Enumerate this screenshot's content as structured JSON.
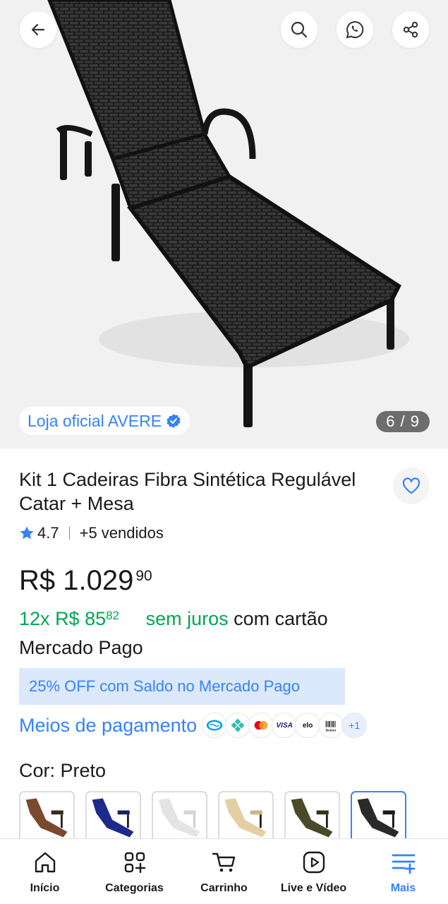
{
  "gallery": {
    "store_label": "Loja oficial AVERE",
    "counter": "6 / 9"
  },
  "product": {
    "title": "Kit 1 Cadeiras Fibra Sintética Regulável Catar + Mesa",
    "rating": "4.7",
    "sold": "+5 vendidos",
    "price_integer": "R$ 1.029",
    "price_cents": "90",
    "installments_count": "12x",
    "installment_value": "R$ 85",
    "installment_cents": "82",
    "installment_interest": "sem juros",
    "installment_suffix": "com cartão",
    "installment_line2": "Mercado Pago",
    "promo": "25% OFF com Saldo no Mercado Pago",
    "payment_link": "Meios de pagamento",
    "payment_icons": [
      "mercado-pago",
      "pix",
      "mastercard",
      "VISA",
      "elo",
      "Boleto"
    ],
    "payment_more": "+1",
    "color_label": "Cor: Preto",
    "swatches": [
      {
        "name": "Marrom",
        "color": "#7a4a2e"
      },
      {
        "name": "Azul",
        "color": "#1e2a8a"
      },
      {
        "name": "Branco",
        "color": "#e8e8e8"
      },
      {
        "name": "Bege",
        "color": "#e3cfa1"
      },
      {
        "name": "Verde",
        "color": "#4a4a2a"
      },
      {
        "name": "Preto",
        "color": "#2a2a2a",
        "selected": true
      }
    ]
  },
  "nav": {
    "home": "Início",
    "categories": "Categorias",
    "cart": "Carrinho",
    "live": "Live e Vídeo",
    "more": "Mais"
  },
  "colors": {
    "accent": "#3483fa",
    "green": "#00a650",
    "promo_bg": "#dce9fc"
  }
}
